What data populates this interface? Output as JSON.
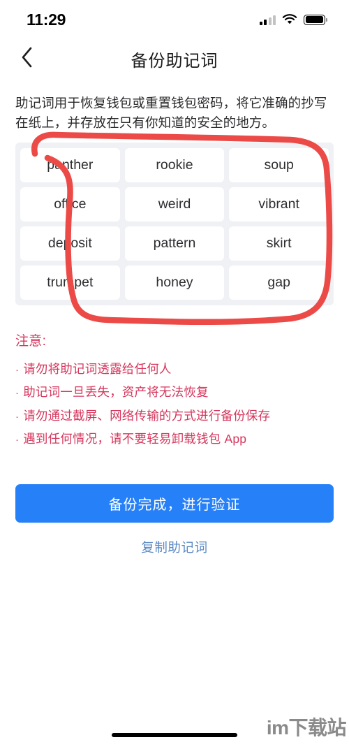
{
  "status_bar": {
    "time": "11:29",
    "signal_icon": "cellular-signal-icon",
    "wifi_icon": "wifi-icon",
    "battery_icon": "battery-full-icon"
  },
  "nav": {
    "back_icon": "chevron-left-icon",
    "title": "备份助记词"
  },
  "description": "助记词用于恢复钱包或重置钱包密码，将它准确的抄写在纸上，并存放在只有你知道的安全的地方。",
  "mnemonic": {
    "words": [
      "panther",
      "rookie",
      "soup",
      "office",
      "weird",
      "vibrant",
      "deposit",
      "pattern",
      "skirt",
      "trumpet",
      "honey",
      "gap"
    ],
    "annotation_color": "#ec4a47"
  },
  "warning": {
    "title": "注意:",
    "bullet": "·",
    "items": [
      "请勿将助记词透露给任何人",
      "助记词一旦丢失，资产将无法恢复",
      "请勿通过截屏、网络传输的方式进行备份保存",
      "遇到任何情况，请不要轻易卸载钱包 App"
    ],
    "color": "#d6365c"
  },
  "actions": {
    "primary_label": "备份完成，进行验证",
    "primary_color": "#2680f7",
    "copy_label": "复制助记词",
    "copy_color": "#5b8ac4"
  },
  "watermark": "im下载站"
}
